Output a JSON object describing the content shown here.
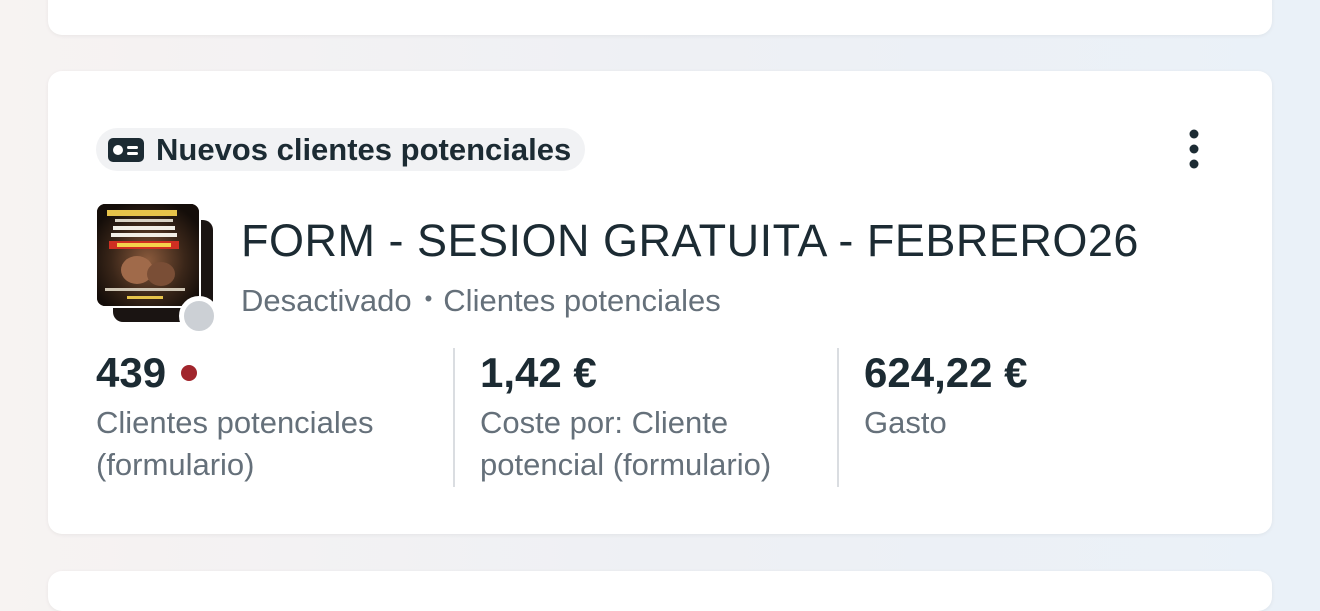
{
  "card": {
    "objective": {
      "icon": "lead-form-icon",
      "label": "Nuevos clientes potenciales"
    },
    "menu_icon": "more-vertical-icon",
    "ad": {
      "title": "FORM - SESION GRATUITA - FEBRERO26",
      "status": "Desactivado",
      "separator": "•",
      "type": "Clientes potenciales",
      "status_color": "#ccd0d5"
    },
    "metrics": [
      {
        "value": "439",
        "label_line1": "Clientes potenciales",
        "label_line2": "(formulario)",
        "alert_color": "#a1252c"
      },
      {
        "value": "1,42 €",
        "label_line1": "Coste por: Cliente",
        "label_line2": "potencial (formulario)"
      },
      {
        "value": "624,22 €",
        "label_line1": "Gasto",
        "label_line2": ""
      }
    ]
  }
}
